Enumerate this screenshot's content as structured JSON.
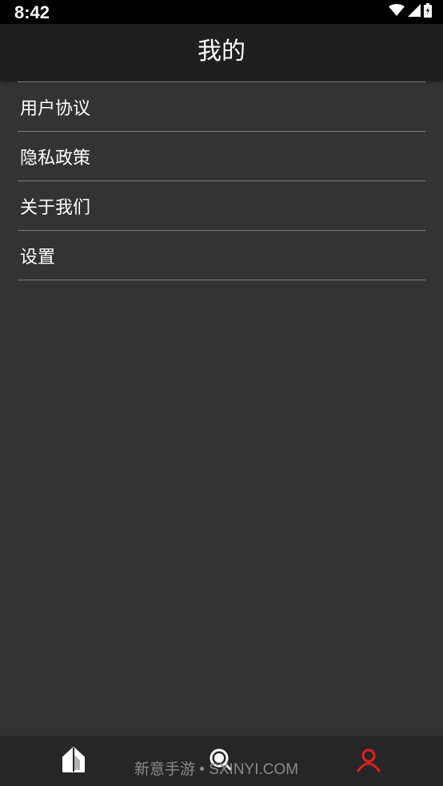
{
  "status_bar": {
    "time": "8:42",
    "icons": [
      "wifi-icon",
      "signal-icon",
      "battery-icon"
    ]
  },
  "header": {
    "title": "我的"
  },
  "menu": {
    "items": [
      {
        "label": "用户协议"
      },
      {
        "label": "隐私政策"
      },
      {
        "label": "关于我们"
      },
      {
        "label": "设置"
      }
    ]
  },
  "tab_bar": {
    "tabs": [
      {
        "name": "home",
        "icon": "home-icon",
        "active": false
      },
      {
        "name": "search",
        "icon": "search-icon",
        "active": false
      },
      {
        "name": "mine",
        "icon": "user-icon",
        "active": true
      }
    ],
    "active_color": "#e02020",
    "inactive_color": "#ffffff"
  },
  "watermark": {
    "text": "新意手游 • SXINYI.COM"
  },
  "colors": {
    "background": "#333333",
    "header_bg": "#1f1f1f",
    "status_bg": "#000000",
    "divider": "#7a7a7a"
  }
}
